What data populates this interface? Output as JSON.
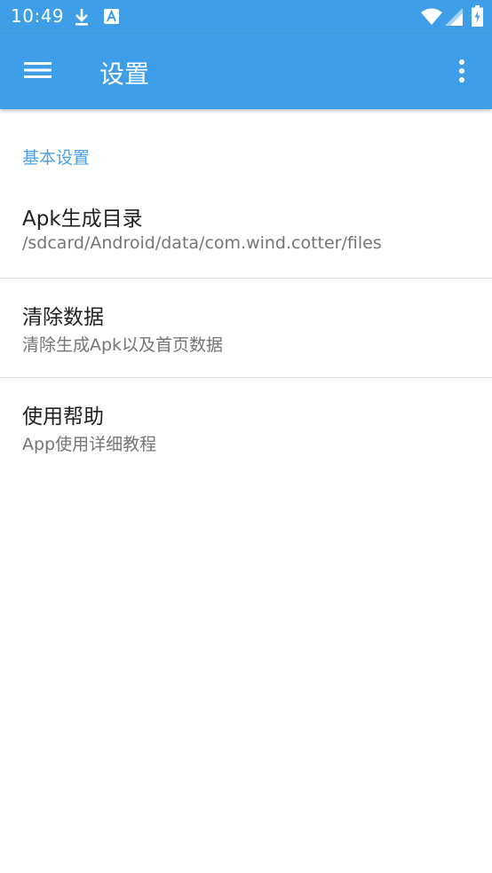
{
  "status_bar": {
    "time": "10:49",
    "left_icons": [
      "download-icon",
      "app-notification-icon"
    ],
    "right_icons": [
      "wifi-icon",
      "signal-icon",
      "battery-icon"
    ]
  },
  "app_bar": {
    "title": "设置",
    "background": "#3f9ee8",
    "nav_icon": "menu-icon",
    "overflow_icon": "more-vert-icon"
  },
  "settings": {
    "section_header": "基本设置",
    "items": [
      {
        "title": "Apk生成目录",
        "summary": "/sdcard/Android/data/com.wind.cotter/files"
      },
      {
        "title": "清除数据",
        "summary": "清除生成Apk以及首页数据"
      },
      {
        "title": "使用帮助",
        "summary": "App使用详细教程"
      }
    ]
  },
  "colors": {
    "accent": "#4c9fe3",
    "title_text": "#212121",
    "summary_text": "#757575",
    "divider": "#dcdcdc"
  }
}
